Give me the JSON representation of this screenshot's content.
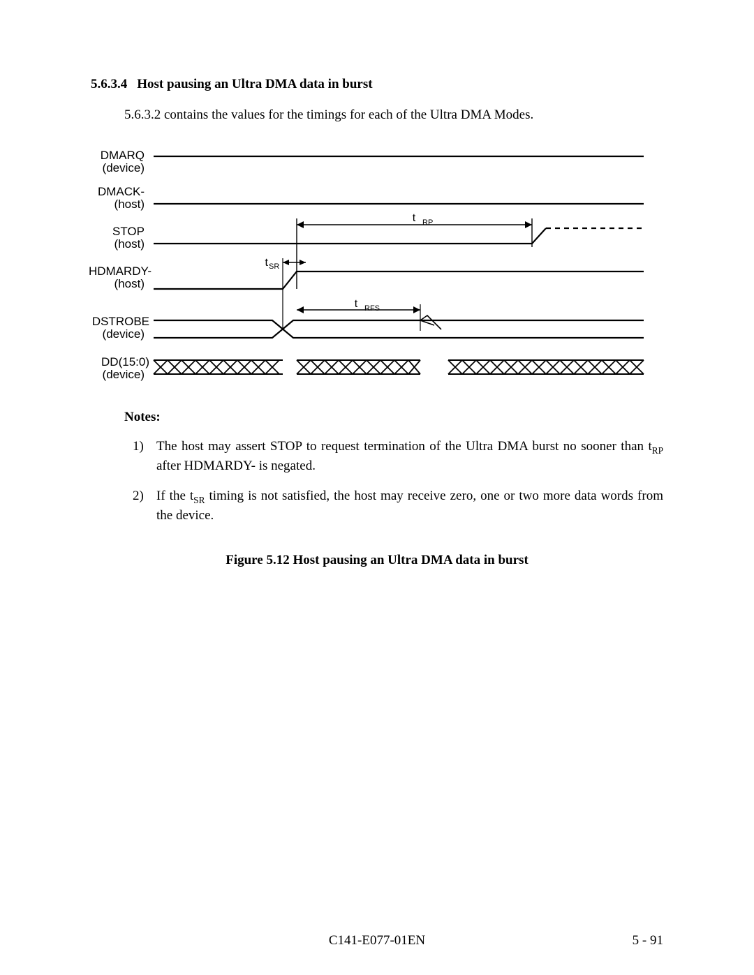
{
  "section": {
    "number": "5.6.3.4",
    "title": "Host pausing an Ultra DMA data in burst",
    "lead": "5.6.3.2 contains the values for the timings for each of the Ultra DMA Modes."
  },
  "diagram": {
    "signals": [
      {
        "name": "DMARQ",
        "owner": "(device)"
      },
      {
        "name": "DMACK-",
        "owner": "(host)"
      },
      {
        "name": "STOP",
        "owner": "(host)"
      },
      {
        "name": "HDMARDY-",
        "owner": "(host)"
      },
      {
        "name": "DSTROBE",
        "owner": "(device)"
      },
      {
        "name": "DD(15:0)",
        "owner": "(device)"
      }
    ],
    "labels": {
      "tRP": "tRP",
      "tSR": "tSR",
      "tRFS": "tRFS"
    }
  },
  "notes": {
    "heading": "Notes:",
    "items": [
      {
        "n": "1)",
        "html": "The host may assert STOP to request termination of the Ultra DMA burst no sooner than t<sub>RP</sub> after HDMARDY- is negated."
      },
      {
        "n": "2)",
        "html": "If the t<sub>SR</sub> timing is not satisfied, the host may receive zero, one or two more data words from the device."
      }
    ]
  },
  "figure": {
    "caption": "Figure 5.12   Host pausing an Ultra DMA data in burst"
  },
  "footer": {
    "docid": "C141-E077-01EN",
    "page": "5 - 91"
  }
}
